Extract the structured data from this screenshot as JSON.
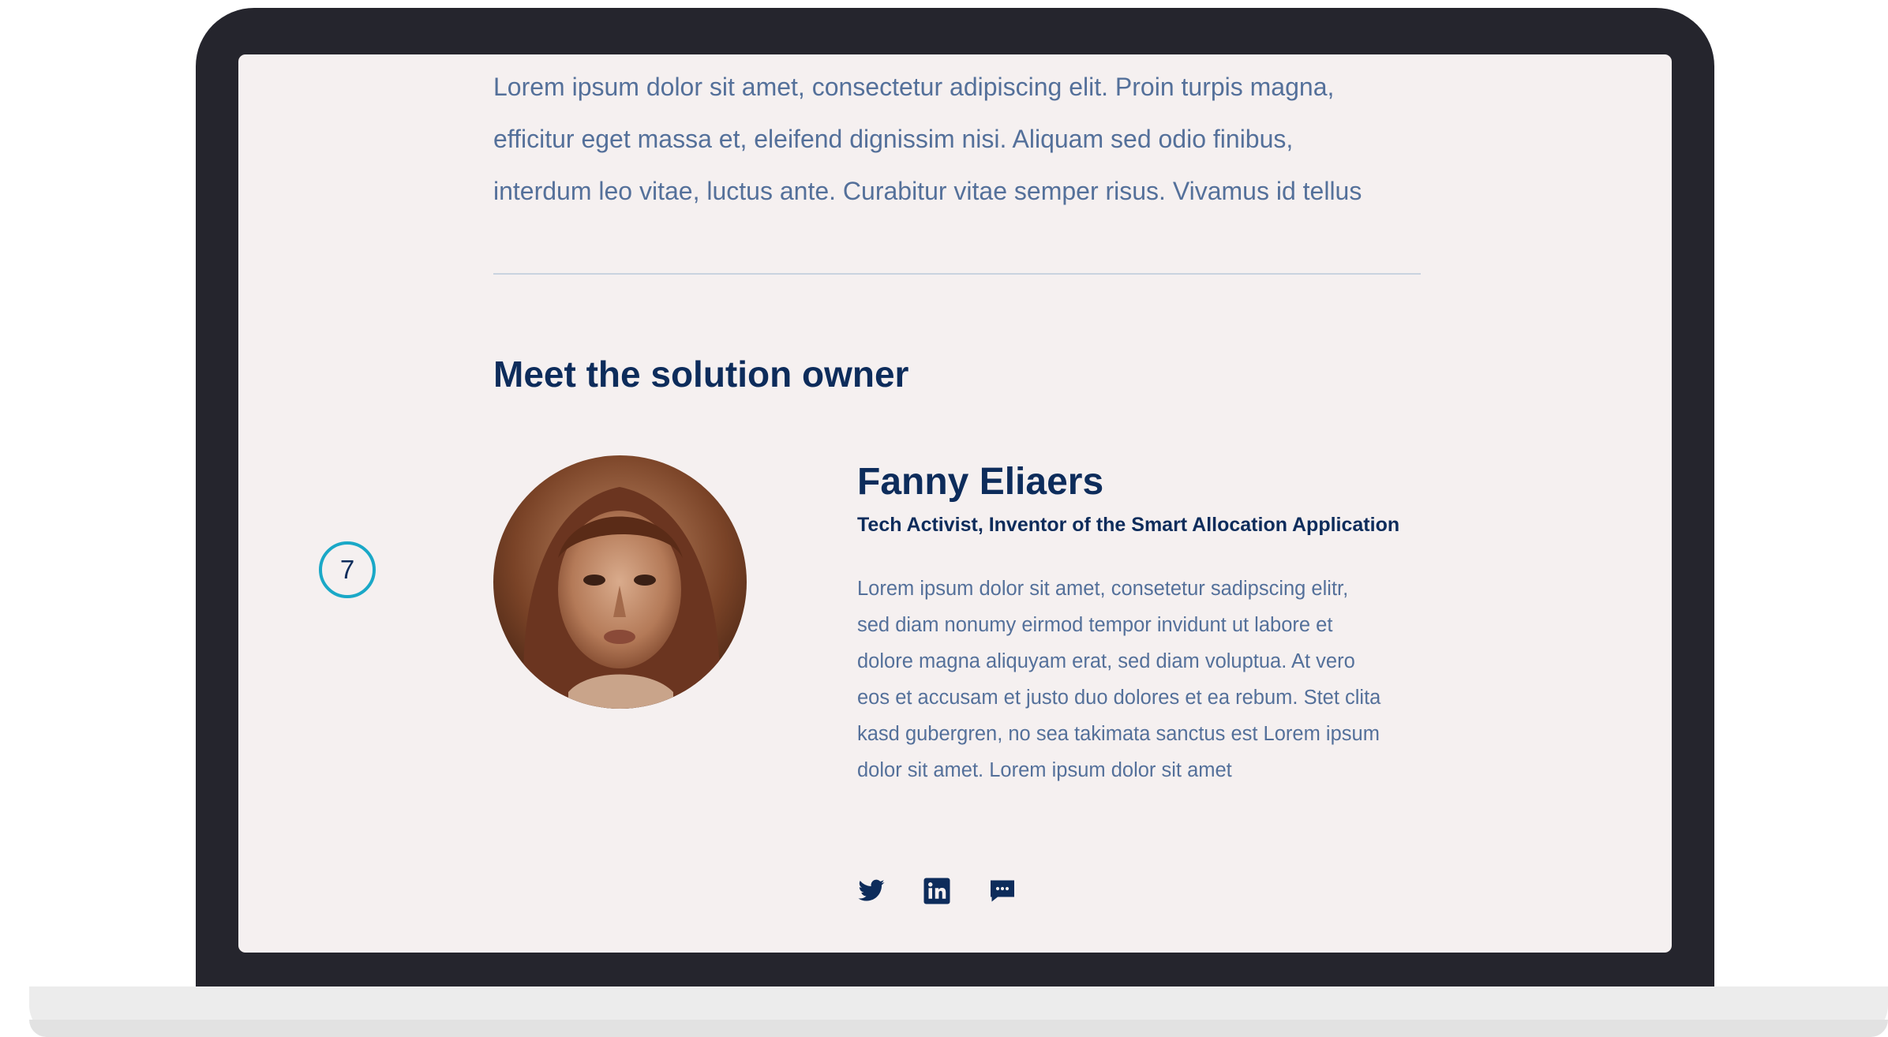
{
  "intro": {
    "paragraph": "Lorem ipsum dolor sit amet, consectetur adipiscing elit. Proin turpis magna,\nefficitur eget massa et, eleifend dignissim nisi. Aliquam sed odio finibus,\ninterdum leo vitae, luctus ante. Curabitur vitae semper risus. Vivamus id tellus"
  },
  "section": {
    "heading": "Meet the solution owner"
  },
  "owner": {
    "name": "Fanny Eliaers",
    "title": "Tech Activist, Inventor of the Smart Allocation Application",
    "bio": "Lorem ipsum dolor sit amet, consetetur sadipscing elitr,\nsed diam nonumy eirmod tempor invidunt ut labore et\ndolore magna aliquyam erat, sed diam voluptua. At vero\neos et accusam et justo duo dolores et ea rebum. Stet clita\nkasd gubergren, no sea takimata sanctus est Lorem ipsum\ndolor sit amet. Lorem ipsum dolor sit amet",
    "social": [
      {
        "name": "twitter-icon"
      },
      {
        "name": "linkedin-icon"
      },
      {
        "name": "chat-icon"
      }
    ]
  },
  "step_badge": {
    "number": "7"
  },
  "colors": {
    "heading": "#0d2c5b",
    "body_text": "#54709a",
    "screen_bg": "#f5f0f0",
    "badge_ring": "#1aa8c7",
    "laptop_frame": "#25252d"
  }
}
